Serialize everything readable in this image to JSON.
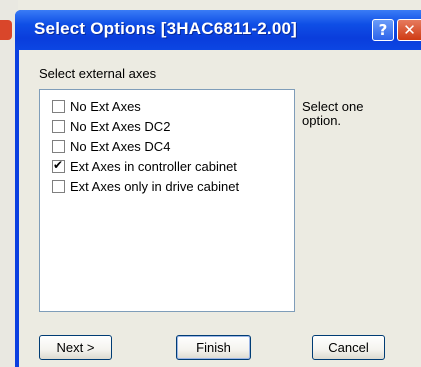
{
  "window": {
    "title": "Select Options [3HAC6811-2.00]",
    "help_glyph": "?",
    "close_glyph": "✕"
  },
  "prompt": "Select external axes",
  "options": [
    {
      "label": "No Ext Axes",
      "checked": false
    },
    {
      "label": "No Ext Axes DC2",
      "checked": false
    },
    {
      "label": "No Ext Axes DC4",
      "checked": false
    },
    {
      "label": "Ext Axes in controller cabinet",
      "checked": true
    },
    {
      "label": "Ext Axes only in drive cabinet",
      "checked": false
    }
  ],
  "help_text": "Select one option.",
  "buttons": {
    "next": "Next >",
    "finish": "Finish",
    "cancel": "Cancel"
  },
  "colors": {
    "titlebar": "#0a3ddc",
    "close_button": "#cf3b14",
    "dialog_background": "#ecebe2"
  }
}
